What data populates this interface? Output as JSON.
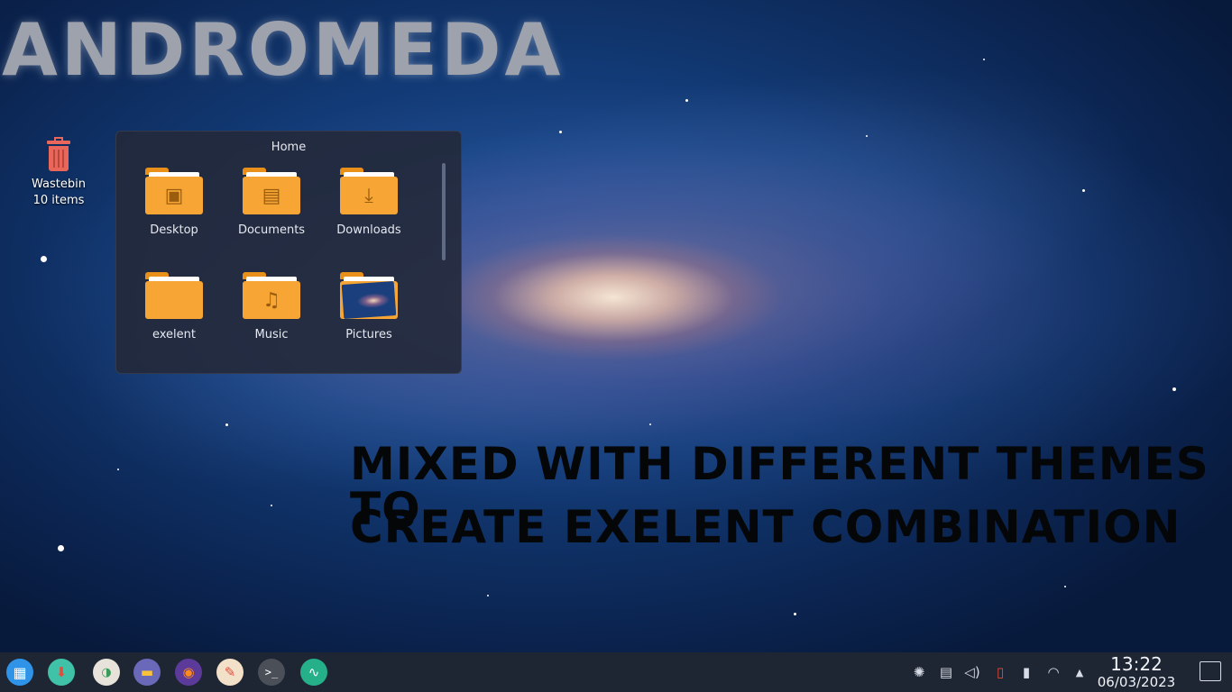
{
  "desktop": {
    "logo_text": "ANDROMEDA",
    "overlay_line1": "MIXED WITH DIFFERENT THEMES TO",
    "overlay_line2": "CREATE EXELENT COMBINATION",
    "icons": [
      {
        "label": "Wastebin",
        "sublabel": "10 items",
        "icon": "wastebin-icon"
      }
    ]
  },
  "folder_view": {
    "title": "Home",
    "items": [
      {
        "label": "Desktop",
        "icon": "folder-desktop-icon"
      },
      {
        "label": "Documents",
        "icon": "folder-documents-icon"
      },
      {
        "label": "Downloads",
        "icon": "folder-downloads-icon"
      },
      {
        "label": "exelent",
        "icon": "folder-icon"
      },
      {
        "label": "Music",
        "icon": "folder-music-icon"
      },
      {
        "label": "Pictures",
        "icon": "folder-pictures-icon"
      }
    ]
  },
  "taskbar": {
    "apps": [
      {
        "icon": "start-menu-icon"
      },
      {
        "icon": "software-center-icon"
      },
      {
        "icon": "settings-toggle-icon"
      },
      {
        "icon": "file-manager-icon"
      },
      {
        "icon": "firefox-icon"
      },
      {
        "icon": "task-app-icon"
      },
      {
        "icon": "terminal-icon"
      },
      {
        "icon": "system-monitor-icon"
      }
    ],
    "tray": [
      {
        "icon": "aperture-icon"
      },
      {
        "icon": "clipboard-icon"
      },
      {
        "icon": "volume-icon"
      },
      {
        "icon": "battery-icon"
      },
      {
        "icon": "phone-connect-icon"
      },
      {
        "icon": "wifi-icon"
      },
      {
        "icon": "tray-expand-icon"
      }
    ],
    "clock": {
      "time": "13:22",
      "date": "06/03/2023"
    }
  },
  "colors": {
    "folder": "#f7a534",
    "taskbar_bg": "#1e2633",
    "trash": "#e8675a"
  }
}
